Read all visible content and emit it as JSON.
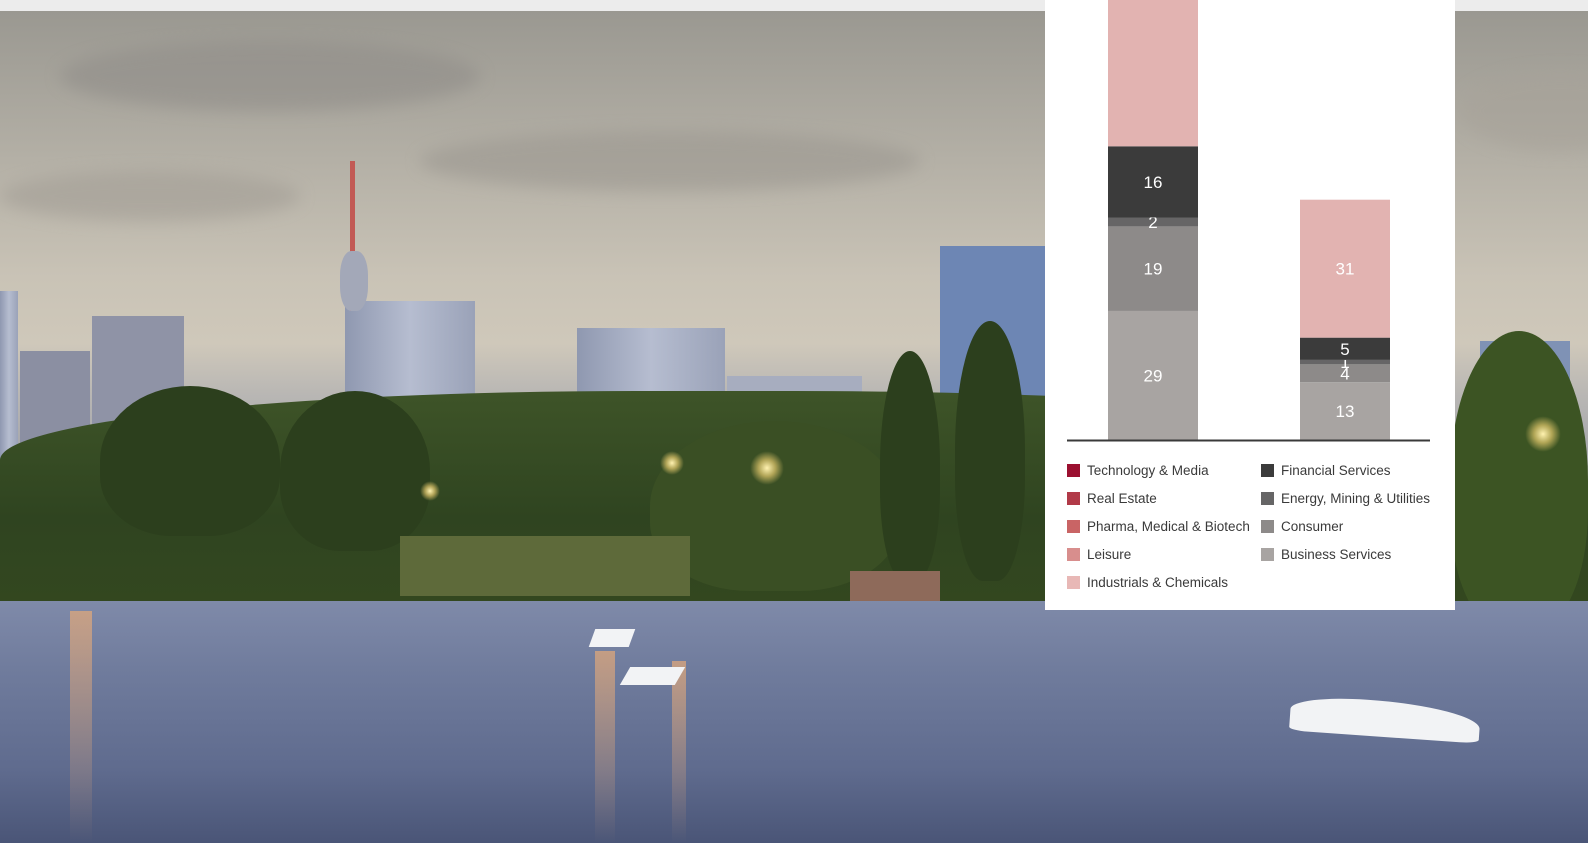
{
  "chart_data": {
    "type": "bar",
    "stacked": true,
    "categories": [
      "",
      ""
    ],
    "series": [
      {
        "name": "Business Services",
        "color": "#a8a4a2",
        "values": [
          29,
          13
        ]
      },
      {
        "name": "Consumer",
        "color": "#8d8a89",
        "values": [
          19,
          4
        ]
      },
      {
        "name": "Energy, Mining & Utilities",
        "color": "#666566",
        "values": [
          2,
          1
        ]
      },
      {
        "name": "Financial Services",
        "color": "#3b3b3b",
        "values": [
          16,
          5
        ]
      },
      {
        "name": "Industrials & Chemicals",
        "color": "#e2b3b1",
        "values": [
          null,
          31
        ]
      }
    ],
    "legend": [
      {
        "name": "Technology & Media",
        "color": "#9b1030"
      },
      {
        "name": "Real Estate",
        "color": "#b13a48"
      },
      {
        "name": "Pharma, Medical & Biotech",
        "color": "#c96465"
      },
      {
        "name": "Leisure",
        "color": "#d88e8d"
      },
      {
        "name": "Industrials & Chemicals",
        "color": "#e8b8b6"
      },
      {
        "name": "Financial Services",
        "color": "#3b3b3b"
      },
      {
        "name": "Energy, Mining & Utilities",
        "color": "#666566"
      },
      {
        "name": "Consumer",
        "color": "#8d8a89"
      },
      {
        "name": "Business Services",
        "color": "#a8a4a2"
      }
    ],
    "legend_placement": "bottom",
    "grid": false,
    "value_labels": true
  }
}
